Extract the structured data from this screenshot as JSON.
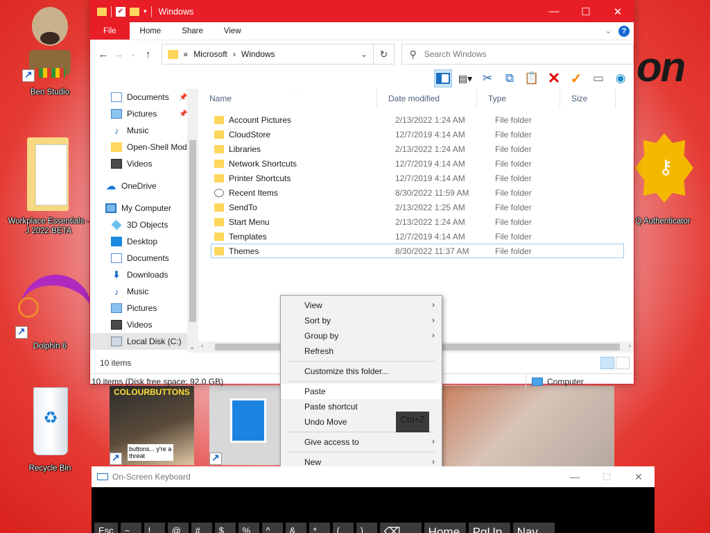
{
  "desktop": {
    "icons": [
      {
        "label": "Ben Studio"
      },
      {
        "label": "Workplace Essentials - J 2022 BETA"
      },
      {
        "label": "Dolphin 6"
      },
      {
        "label": "Recycle Bin"
      },
      {
        "label": "Q Authenticator"
      }
    ],
    "brand_text": "on",
    "thumb_text": "COLOURBUTTONS",
    "thumb_bubble": "buttons... y're a threat"
  },
  "explorer": {
    "title": "Windows",
    "ribbon_tabs": [
      "File",
      "Home",
      "Share",
      "View"
    ],
    "address": {
      "prefix": "«",
      "crumbs": [
        "Microsoft",
        "›",
        "Windows"
      ]
    },
    "search_placeholder": "Search Windows",
    "nav_pane": [
      {
        "label": "Documents",
        "icon": "doc",
        "pinned": true
      },
      {
        "label": "Pictures",
        "icon": "pic",
        "pinned": true
      },
      {
        "label": "Music",
        "icon": "music"
      },
      {
        "label": "Open-Shell Mod",
        "icon": "fold"
      },
      {
        "label": "Videos",
        "icon": "vid"
      },
      {
        "label": "OneDrive",
        "icon": "cloud"
      },
      {
        "label": "My Computer",
        "icon": "pc"
      },
      {
        "label": "3D Objects",
        "icon": "obj3d"
      },
      {
        "label": "Desktop",
        "icon": "desk"
      },
      {
        "label": "Documents",
        "icon": "doc"
      },
      {
        "label": "Downloads",
        "icon": "down"
      },
      {
        "label": "Music",
        "icon": "music"
      },
      {
        "label": "Pictures",
        "icon": "pic"
      },
      {
        "label": "Videos",
        "icon": "vid"
      },
      {
        "label": "Local Disk (C:)",
        "icon": "disk"
      }
    ],
    "columns": [
      "Name",
      "Date modified",
      "Type",
      "Size"
    ],
    "files": [
      {
        "name": "Account Pictures",
        "date": "2/13/2022 1:24 AM",
        "type": "File folder"
      },
      {
        "name": "CloudStore",
        "date": "12/7/2019 4:14 AM",
        "type": "File folder"
      },
      {
        "name": "Libraries",
        "date": "2/13/2022 1:24 AM",
        "type": "File folder"
      },
      {
        "name": "Network Shortcuts",
        "date": "12/7/2019 4:14 AM",
        "type": "File folder"
      },
      {
        "name": "Printer Shortcuts",
        "date": "12/7/2019 4:14 AM",
        "type": "File folder"
      },
      {
        "name": "Recent Items",
        "date": "8/30/2022 11:59 AM",
        "type": "File folder"
      },
      {
        "name": "SendTo",
        "date": "2/13/2022 1:25 AM",
        "type": "File folder"
      },
      {
        "name": "Start Menu",
        "date": "2/13/2022 1:24 AM",
        "type": "File folder"
      },
      {
        "name": "Templates",
        "date": "12/7/2019 4:14 AM",
        "type": "File folder"
      },
      {
        "name": "Themes",
        "date": "8/30/2022 11:37 AM",
        "type": "File folder"
      }
    ],
    "selected_file": "Themes",
    "status_count": "10 items",
    "info_text": "10 items (Disk free space: 92.0 GB)",
    "info_location": "Computer"
  },
  "context_menu": {
    "items": [
      {
        "label": "View",
        "submenu": true
      },
      {
        "label": "Sort by",
        "submenu": true
      },
      {
        "label": "Group by",
        "submenu": true
      },
      {
        "label": "Refresh"
      },
      {
        "separator": true
      },
      {
        "label": "Customize this folder..."
      },
      {
        "separator": true
      },
      {
        "label": "Paste",
        "hover": true
      },
      {
        "label": "Paste shortcut"
      },
      {
        "label": "Undo Move",
        "shortcut": "Ctrl+Z"
      },
      {
        "separator": true
      },
      {
        "label": "Give access to",
        "submenu": true
      },
      {
        "separator": true
      },
      {
        "label": "New",
        "submenu": true
      }
    ]
  },
  "osk": {
    "title": "On-Screen Keyboard",
    "keys": [
      "Esc",
      "~",
      "!",
      "@",
      "#",
      "$",
      "%",
      "^",
      "&",
      "*",
      "(",
      ")",
      "⌫",
      "Home",
      "PgUp",
      "Nav"
    ]
  }
}
